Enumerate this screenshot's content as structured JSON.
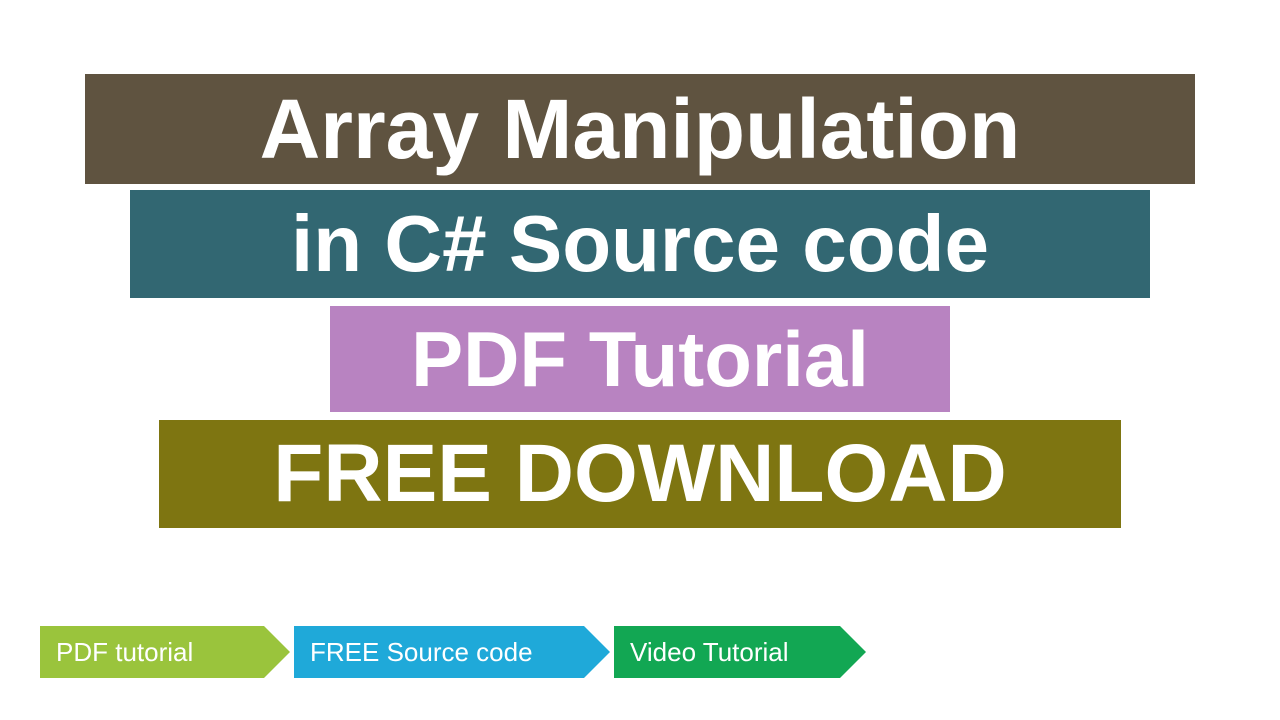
{
  "banners": {
    "line1": "Array Manipulation",
    "line2": "in C# Source code",
    "line3": "PDF Tutorial",
    "line4": "FREE DOWNLOAD"
  },
  "chevrons": {
    "item1": "PDF tutorial",
    "item2": "FREE Source code",
    "item3": "Video Tutorial"
  },
  "colors": {
    "bar1": "#5f5340",
    "bar2": "#326772",
    "bar3": "#b883c1",
    "bar4": "#7e7511",
    "chev1": "#9ac43c",
    "chev2": "#1fa9d9",
    "chev3": "#12a753"
  }
}
